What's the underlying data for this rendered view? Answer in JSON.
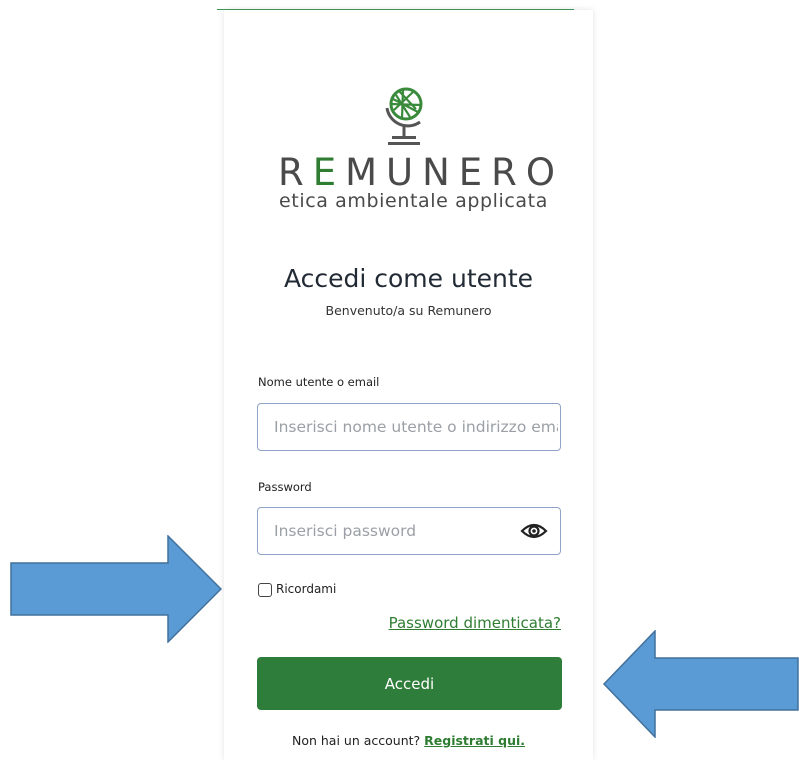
{
  "brand": {
    "name_prefix": "R",
    "name_accent": "E",
    "name_suffix": "MUNERO",
    "tagline": "etica ambientale applicata"
  },
  "login": {
    "title": "Accedi come utente",
    "subtitle": "Benvenuto/a su Remunero",
    "username_label": "Nome utente o email",
    "username_placeholder": "Inserisci nome utente o indirizzo email",
    "password_label": "Password",
    "password_placeholder": "Inserisci password",
    "remember_label": "Ricordami",
    "forgot_link": "Password dimenticata?",
    "submit_label": "Accedi",
    "no_account_text": "Non hai un account?",
    "register_link": "Registrati qui."
  },
  "icons": {
    "logo": "globe-icon",
    "show_password": "eye-icon",
    "annotation_left": "arrow-right-icon",
    "annotation_right": "arrow-left-icon"
  },
  "colors": {
    "accent_green": "#2f7d32",
    "button_green": "#2f7d3a",
    "annotation_blue": "#5b9bd5"
  }
}
